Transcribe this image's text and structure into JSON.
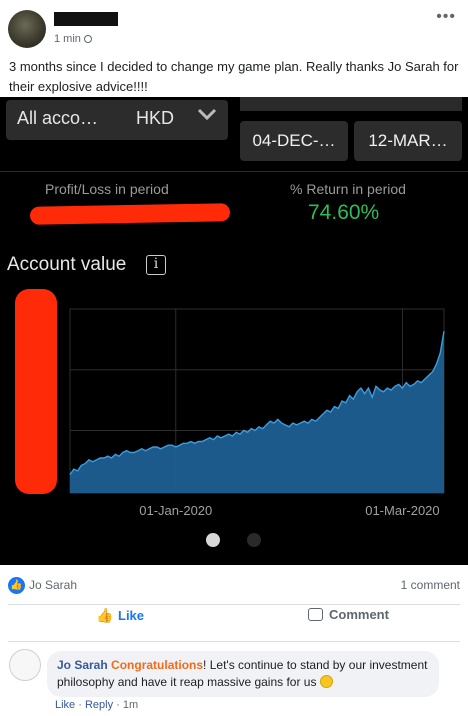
{
  "post": {
    "time": "1 min",
    "text": "3 months since I decided to change my game plan. Really thanks Jo Sarah for their explosive advice!!!!"
  },
  "app": {
    "account_label": "All acco…",
    "currency": "HKD",
    "date_start": "04-DEC-…",
    "date_end": "12-MAR…",
    "profit_label": "Profit/Loss in period",
    "return_label": "% Return in period",
    "return_value": "74.60%",
    "account_value_label": "Account value",
    "info_icon_glyph": "i",
    "colors": {
      "return_positive": "#2dbd57",
      "area_fill": "#1f5f93",
      "line": "#3b9ee0",
      "redaction": "#ff2b08"
    }
  },
  "chart_data": {
    "type": "area",
    "x_tick_labels": [
      "01-Jan-2020",
      "01-Mar-2020"
    ],
    "x_ticks": [
      28,
      88
    ],
    "xlim": [
      0,
      99
    ],
    "ylim": [
      0,
      100
    ],
    "grid": true,
    "y": [
      10,
      13,
      12,
      15,
      16,
      18,
      17,
      18,
      19,
      19,
      20,
      19,
      21,
      20,
      22,
      23,
      22,
      22,
      23,
      24,
      23,
      24,
      25,
      25,
      24,
      25,
      26,
      26,
      25,
      26,
      27,
      27,
      28,
      27,
      28,
      28,
      29,
      30,
      29,
      31,
      30,
      31,
      32,
      31,
      33,
      32,
      34,
      33,
      35,
      34,
      36,
      35,
      37,
      39,
      38,
      40,
      38,
      37,
      36,
      38,
      37,
      38,
      39,
      38,
      40,
      39,
      41,
      43,
      45,
      44,
      47,
      46,
      50,
      49,
      53,
      51,
      55,
      57,
      54,
      57,
      52,
      58,
      56,
      55,
      57,
      56,
      58,
      59,
      57,
      60,
      58,
      59,
      61,
      60,
      62,
      64,
      66,
      70,
      76,
      88
    ]
  },
  "reactions": {
    "reactor": "Jo Sarah",
    "comment_count": "1 comment",
    "like_label": "Like",
    "comment_label": "Comment"
  },
  "comment": {
    "author": "Jo Sarah",
    "highlight": "Congratulations",
    "text": "! Let's continue to stand by our investment philosophy and have it reap massive gains for us",
    "like_link": "Like",
    "reply_link": "Reply",
    "time": "1m"
  }
}
